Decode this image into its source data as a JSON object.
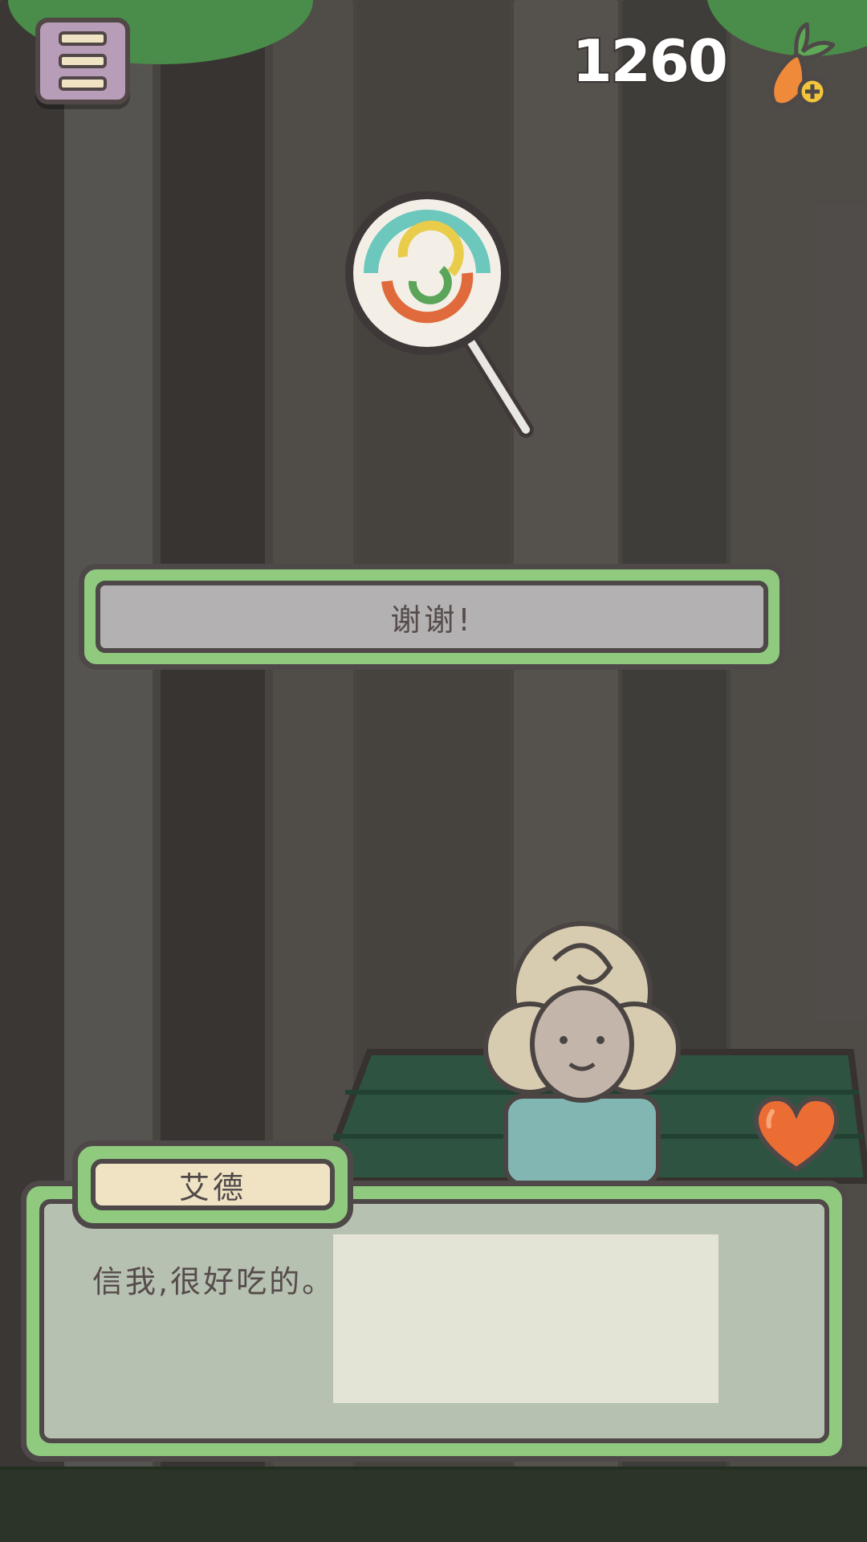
{
  "hud": {
    "carrot_count": "1260",
    "menu_icon": "menu-icon",
    "carrot_icon": "carrot-add-icon"
  },
  "gift_item": {
    "icon": "lollipop-icon"
  },
  "reply_option": {
    "label": "谢谢!"
  },
  "dialogue": {
    "speaker": "艾德",
    "text": "信我,很好吃的。"
  },
  "character": {
    "icon": "sheep-character"
  },
  "affection": {
    "icon": "heart-icon"
  },
  "colors": {
    "accent_green": "#8fca7e",
    "outline": "#4f4848",
    "name_bg": "#efe3c4",
    "heart": "#ec6d34"
  }
}
